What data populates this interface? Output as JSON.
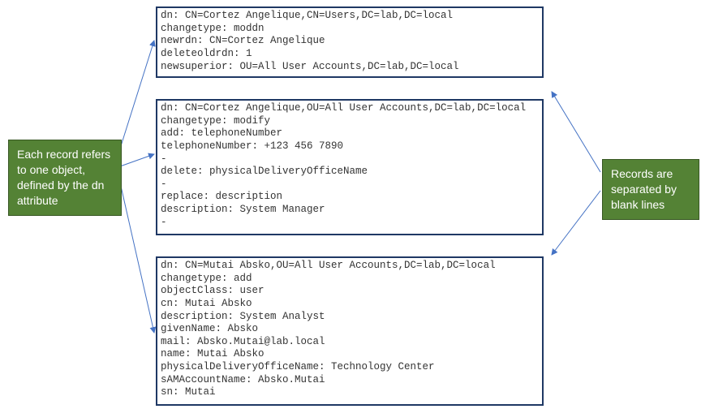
{
  "callouts": {
    "left": "Each record refers\nto one object,\ndefined by the dn\nattribute",
    "right": "Records are\nseparated by\nblank lines"
  },
  "records": {
    "r1": "dn: CN=Cortez Angelique,CN=Users,DC=lab,DC=local\nchangetype: moddn\nnewrdn: CN=Cortez Angelique\ndeleteoldrdn: 1\nnewsuperior: OU=All User Accounts,DC=lab,DC=local",
    "r2": "dn: CN=Cortez Angelique,OU=All User Accounts,DC=lab,DC=local\nchangetype: modify\nadd: telephoneNumber\ntelephoneNumber: +123 456 7890\n-\ndelete: physicalDeliveryOfficeName\n-\nreplace: description\ndescription: System Manager\n-",
    "r3": "dn: CN=Mutai Absko,OU=All User Accounts,DC=lab,DC=local\nchangetype: add\nobjectClass: user\ncn: Mutai Absko\ndescription: System Analyst\ngivenName: Absko\nmail: Absko.Mutai@lab.local\nname: Mutai Absko\nphysicalDeliveryOfficeName: Technology Center\nsAMAccountName: Absko.Mutai\nsn: Mutai"
  },
  "colors": {
    "border": "#1f3864",
    "callout_bg": "#548235",
    "callout_border": "#385723",
    "arrow": "#4472c4"
  }
}
